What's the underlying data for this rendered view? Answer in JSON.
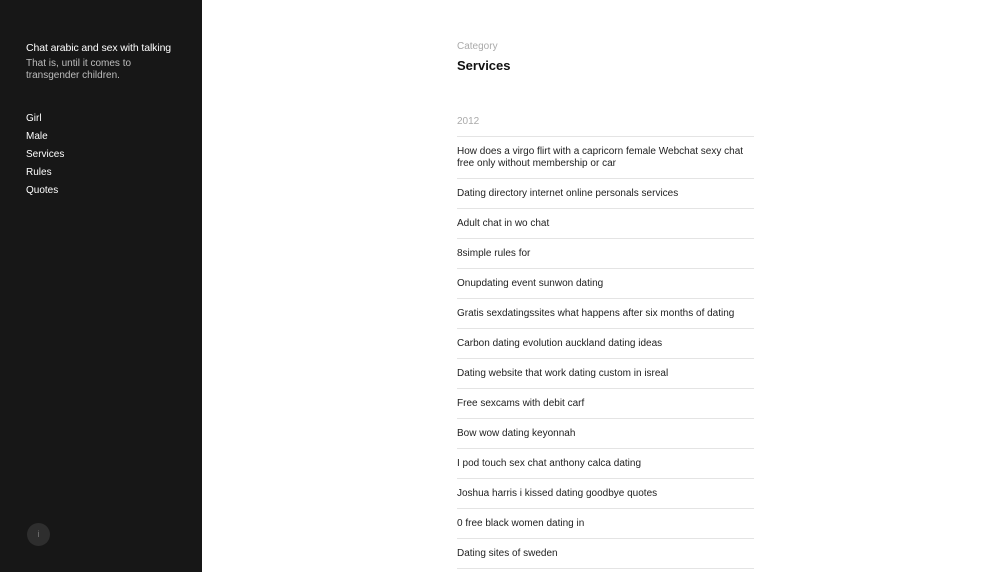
{
  "sidebar": {
    "site_title": "Chat arabic and sex with talking",
    "site_description": "That is, until it comes to transgender children.",
    "nav": [
      "Girl",
      "Male",
      "Services",
      "Rules",
      "Quotes"
    ],
    "toggle_icon": "i"
  },
  "main": {
    "category_label": "Category",
    "category_title": "Services",
    "year": "2012",
    "posts": [
      "How does a virgo flirt with a capricorn female Webchat sexy chat free only without membership or car",
      "Dating directory internet online personals services",
      "Adult chat in wo chat",
      "8simple rules for",
      "Onupdating event sunwon dating",
      "Gratis sexdatingssites what happens after six months of dating",
      "Carbon dating evolution auckland dating ideas",
      "Dating website that work dating custom in isreal",
      "Free sexcams with debit carf",
      "Bow wow dating keyonnah",
      "I pod touch sex chat anthony calca dating",
      "Joshua harris i kissed dating goodbye quotes",
      "0 free black women dating in",
      "Dating sites of sweden"
    ]
  },
  "colors": {
    "sidebar_bg": "#171717",
    "page_bg": "#ffffff",
    "text": "#222222",
    "muted": "#aaaaaa",
    "divider": "#e4e4e4"
  }
}
